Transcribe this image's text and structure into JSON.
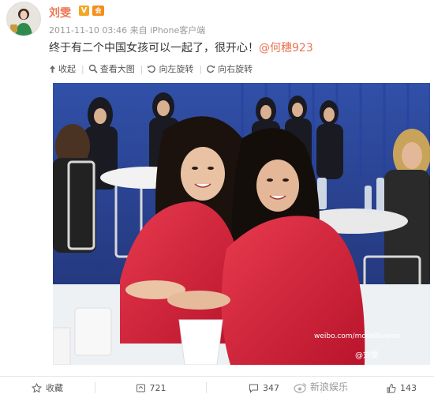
{
  "post": {
    "username": "刘雯",
    "verified_badge": "V",
    "level_badge": "会",
    "timestamp": "2011-11-10 03:46",
    "source_prefix": "来自",
    "source": "iPhone客户端",
    "text": "终于有二个中国女孩可以一起了，很开心！",
    "mention": "@何穗923"
  },
  "toolbar": {
    "collapse": "收起",
    "view_large": "查看大图",
    "rotate_left": "向左旋转",
    "rotate_right": "向右旋转"
  },
  "photo": {
    "watermark_url": "weibo.com/modelliuwen",
    "watermark_handle": "@刘雯"
  },
  "footer": {
    "favorite": "收藏",
    "repost_count": "721",
    "comment_count": "347",
    "like_count": "143"
  },
  "corner_watermark": "新浪娱乐",
  "colors": {
    "accent": "#eb7350",
    "red_robe": "#d8213a",
    "blue_backdrop": "#2a3f8f"
  }
}
